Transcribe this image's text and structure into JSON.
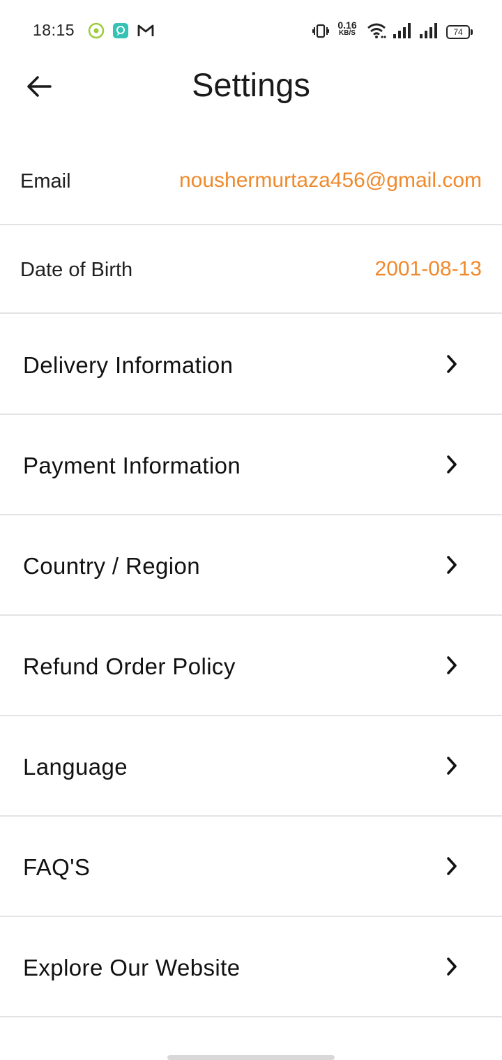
{
  "status_bar": {
    "time": "18:15",
    "net_speed_value": "0.16",
    "net_speed_unit": "KB/S",
    "battery_level": "74",
    "app_icons": [
      "green-circle-app-icon",
      "teal-chat-app-icon",
      "gmail-icon"
    ],
    "system_icons": [
      "vibrate-icon",
      "wifi-icon",
      "signal-1-icon",
      "signal-2-icon",
      "battery-icon"
    ]
  },
  "header": {
    "title": "Settings",
    "back_icon": "arrow-left-icon"
  },
  "profile": {
    "email_label": "Email",
    "email_value": "noushermurtaza456@gmail.com",
    "dob_label": "Date of Birth",
    "dob_value": "2001-08-13"
  },
  "menu": {
    "items": [
      {
        "label": "Delivery Information",
        "icon": "chevron-right-icon"
      },
      {
        "label": "Payment Information",
        "icon": "chevron-right-icon"
      },
      {
        "label": "Country / Region",
        "icon": "chevron-right-icon"
      },
      {
        "label": "Refund Order Policy",
        "icon": "chevron-right-icon"
      },
      {
        "label": "Language",
        "icon": "chevron-right-icon"
      },
      {
        "label": "FAQ'S",
        "icon": "chevron-right-icon"
      },
      {
        "label": "Explore Our Website",
        "icon": "chevron-right-icon"
      }
    ]
  },
  "colors": {
    "accent": "#ef8a2c",
    "text": "#111111",
    "divider": "#e4e4e4",
    "background": "#ffffff"
  }
}
